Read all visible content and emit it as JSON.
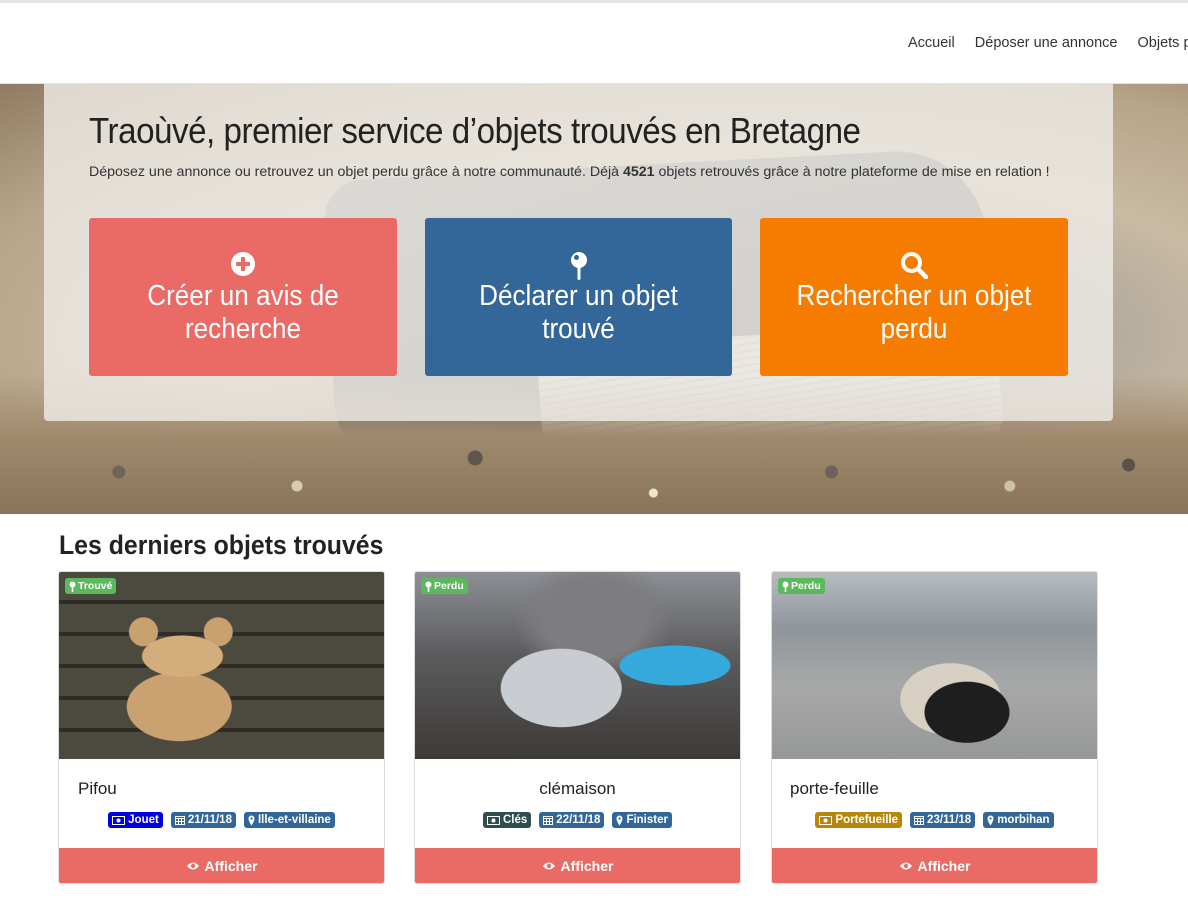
{
  "nav": {
    "items": [
      "Accueil",
      "Déposer une annonce",
      "Objets p"
    ]
  },
  "hero": {
    "title": "Traoùvé, premier service d’objets trouvés en Bretagne",
    "intro_before": "Déposez une annonce ou retrouvez un objet perdu grâce à notre communauté. Déjà ",
    "count": "4521",
    "intro_after": " objets retrouvés grâce à notre plateforme de mise en relation !",
    "actions": [
      {
        "label": "Créer un avis de recherche",
        "icon": "plus-circle-icon",
        "color": "#ea6a66"
      },
      {
        "label": "Déclarer un objet trouvé",
        "icon": "map-pin-icon",
        "color": "#336699"
      },
      {
        "label": "Rechercher un objet perdu",
        "icon": "search-icon",
        "color": "#f57c00"
      }
    ]
  },
  "latest": {
    "title": "Les derniers objets trouvés",
    "cards": [
      {
        "status": "Trouvé",
        "name": "Pifou",
        "category": "Jouet",
        "category_color": "#0000e0",
        "date": "21/11/18",
        "place": "Ille-et-villaine",
        "button": "Afficher",
        "image": "teddy-bear-photo"
      },
      {
        "status": "Perdu",
        "name": "clémaison",
        "category": "Clés",
        "category_color": "#2f4f4f",
        "date": "22/11/18",
        "place": "Finister",
        "button": "Afficher",
        "image": "keys-photo"
      },
      {
        "status": "Perdu",
        "name": "porte-feuille",
        "category": "Portefueille",
        "category_color": "#b8860b",
        "date": "23/11/18",
        "place": "morbihan",
        "button": "Afficher",
        "image": "wallet-photo"
      }
    ]
  }
}
